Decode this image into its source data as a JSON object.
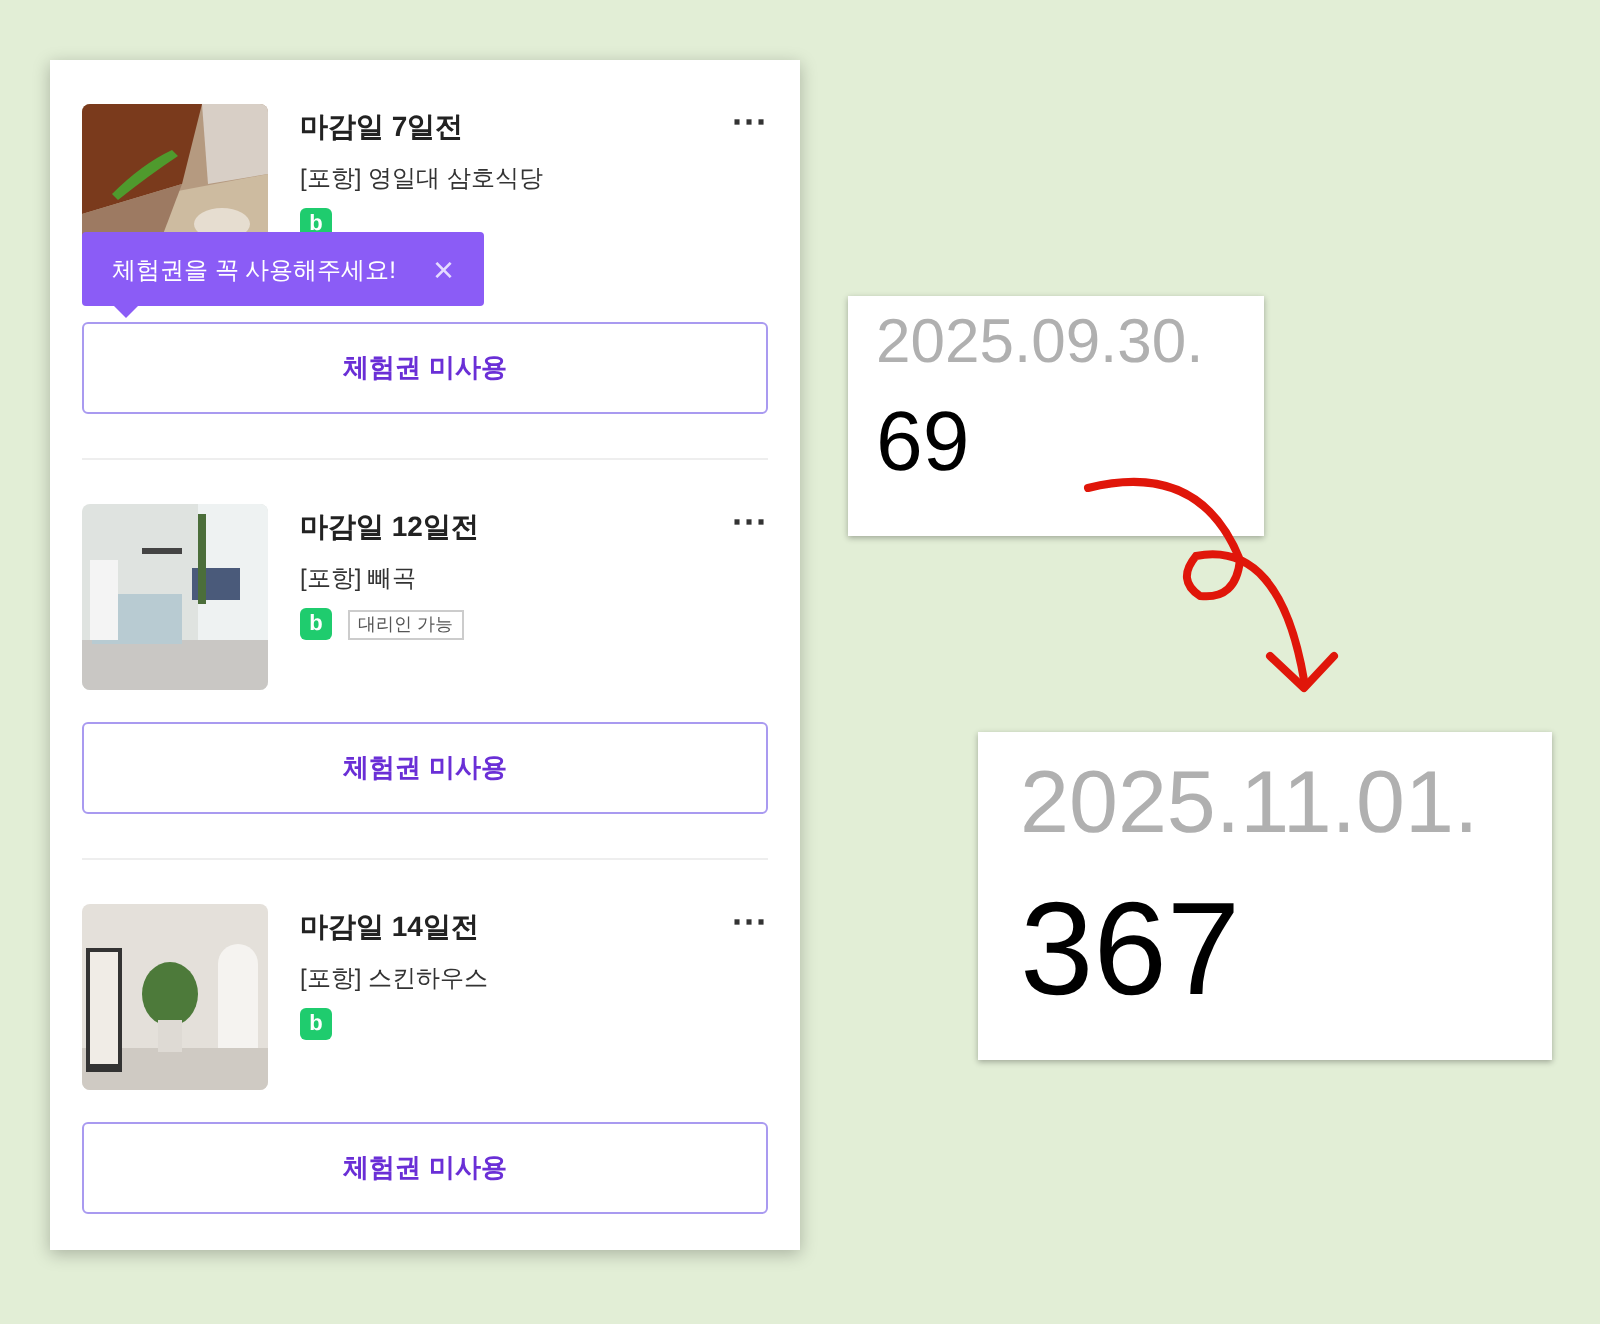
{
  "items": [
    {
      "deadline": "마감일 7일전",
      "location": "[포항] 영일대 삼호식당",
      "badge": "b",
      "tooltip": {
        "text": "체험권을 꼭 사용해주세요!",
        "close": "×"
      },
      "more": "···",
      "button": "체험권 미사용"
    },
    {
      "deadline": "마감일 12일전",
      "location": "[포항] 빼곡",
      "badge": "b",
      "tag": "대리인 가능",
      "more": "···",
      "button": "체험권 미사용"
    },
    {
      "deadline": "마감일 14일전",
      "location": "[포항] 스킨하우스",
      "badge": "b",
      "more": "···",
      "button": "체험권 미사용"
    }
  ],
  "snippets": [
    {
      "date": "2025.09.30.",
      "count": "69"
    },
    {
      "date": "2025.11.01.",
      "count": "367"
    }
  ]
}
